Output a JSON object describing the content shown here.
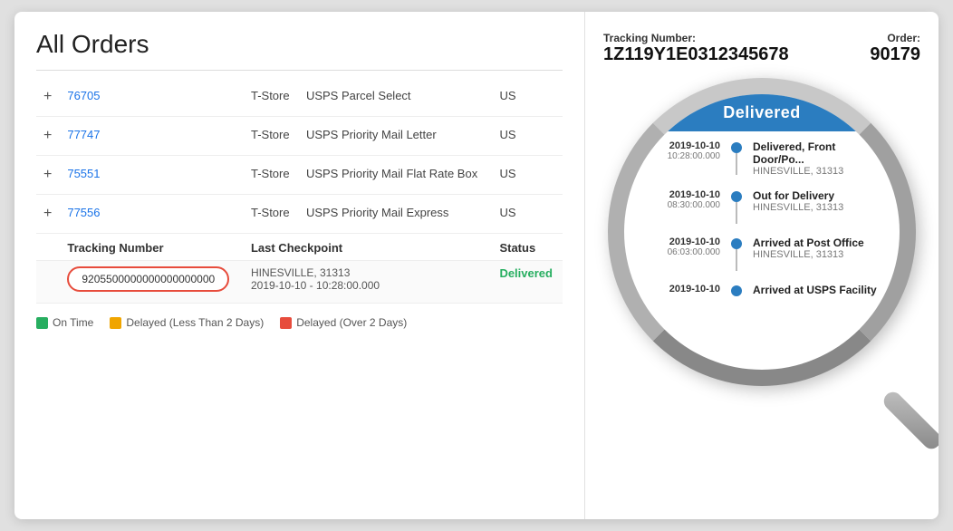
{
  "page": {
    "title": "All Orders"
  },
  "orders": [
    {
      "id": "76705",
      "store": "T-Store",
      "shipping": "USPS Parcel Select",
      "country": "US"
    },
    {
      "id": "77747",
      "store": "T-Store",
      "shipping": "USPS Priority Mail Letter",
      "country": "US"
    },
    {
      "id": "75551",
      "store": "T-Store",
      "shipping": "USPS Priority Mail Flat Rate Box",
      "country": "US"
    },
    {
      "id": "77556",
      "store": "T-Store",
      "shipping": "USPS Priority Mail Express",
      "country": "US"
    }
  ],
  "tracking_sub": {
    "header_tracking": "Tracking Number",
    "header_checkpoint": "Last Checkpoint",
    "header_status": "Status",
    "tracking_number": "9205500000000000000000",
    "last_checkpoint_line1": "HINESVILLE, 31313",
    "last_checkpoint_line2": "2019-10-10 - 10:28:00.000",
    "status": "Delivered"
  },
  "legend": [
    {
      "color": "#27ae60",
      "label": "On Time"
    },
    {
      "color": "#f0a500",
      "label": "Delayed (Less Than 2 Days)"
    },
    {
      "color": "#e74c3c",
      "label": "Delayed (Over 2 Days)"
    }
  ],
  "right_panel": {
    "tracking_label": "Tracking Number:",
    "tracking_value": "1Z119Y1E0312345678",
    "order_label": "Order:",
    "order_value": "90179",
    "delivered_banner": "Delivered",
    "timeline": [
      {
        "date": "2019-10-10",
        "time": "10:28:00.000",
        "event": "Delivered, Front Door/Po...",
        "location": "HINESVILLE, 31313"
      },
      {
        "date": "2019-10-10",
        "time": "08:30:00.000",
        "event": "Out for Delivery",
        "location": "HINESVILLE, 31313"
      },
      {
        "date": "2019-10-10",
        "time": "06:03:00.000",
        "event": "Arrived at Post Office",
        "location": "HINESVILLE, 31313"
      },
      {
        "date": "2019-10-10",
        "time": "",
        "event": "Arrived at USPS Facility",
        "location": ""
      }
    ]
  },
  "colors": {
    "accent_blue": "#2b7dc0",
    "on_time": "#27ae60",
    "delayed_lt": "#f0a500",
    "delayed_gt": "#e74c3c"
  }
}
